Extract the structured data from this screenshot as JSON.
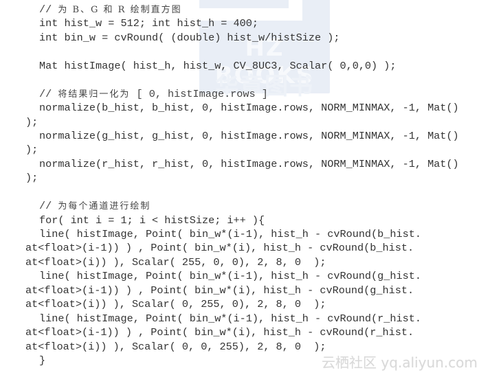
{
  "watermarks": {
    "publisher_en": "HZ BOOKS",
    "publisher_cn": "华章图书",
    "site": "云栖社区 yq.aliyun.com"
  },
  "code": {
    "lines": [
      {
        "type": "comment",
        "indent": "ind",
        "prefix": "// ",
        "text": "为 B、G 和 R 绘制直方图",
        "suffix": ""
      },
      {
        "type": "code",
        "indent": "ind",
        "text": "int hist_w = 512; int hist_h = 400;"
      },
      {
        "type": "code",
        "indent": "ind",
        "text": "int bin_w = cvRound( (double) hist_w/histSize );"
      },
      {
        "type": "blank"
      },
      {
        "type": "code",
        "indent": "ind",
        "text": "Mat histImage( hist_h, hist_w, CV_8UC3, Scalar( 0,0,0) );"
      },
      {
        "type": "blank"
      },
      {
        "type": "comment",
        "indent": "ind",
        "prefix": "// ",
        "text": "将结果归一化为",
        "suffix": " [ 0, histImage.rows ]"
      },
      {
        "type": "code",
        "indent": "ind",
        "text": "normalize(b_hist, b_hist, 0, histImage.rows, NORM_MINMAX, -1, Mat()"
      },
      {
        "type": "code",
        "indent": "cont",
        "text": ");"
      },
      {
        "type": "code",
        "indent": "ind",
        "text": "normalize(g_hist, g_hist, 0, histImage.rows, NORM_MINMAX, -1, Mat()"
      },
      {
        "type": "code",
        "indent": "cont",
        "text": ");"
      },
      {
        "type": "code",
        "indent": "ind",
        "text": "normalize(r_hist, r_hist, 0, histImage.rows, NORM_MINMAX, -1, Mat()"
      },
      {
        "type": "code",
        "indent": "cont",
        "text": ");"
      },
      {
        "type": "blank"
      },
      {
        "type": "comment",
        "indent": "ind",
        "prefix": "// ",
        "text": "为每个通道进行绘制",
        "suffix": ""
      },
      {
        "type": "code",
        "indent": "ind",
        "text": "for( int i = 1; i < histSize; i++ ){"
      },
      {
        "type": "code",
        "indent": "ind",
        "text": "line( histImage, Point( bin_w*(i-1), hist_h - cvRound(b_hist."
      },
      {
        "type": "code",
        "indent": "cont",
        "text": "at<float>(i-1)) ) , Point( bin_w*(i), hist_h - cvRound(b_hist."
      },
      {
        "type": "code",
        "indent": "cont",
        "text": "at<float>(i)) ), Scalar( 255, 0, 0), 2, 8, 0  );"
      },
      {
        "type": "code",
        "indent": "ind",
        "text": "line( histImage, Point( bin_w*(i-1), hist_h - cvRound(g_hist."
      },
      {
        "type": "code",
        "indent": "cont",
        "text": "at<float>(i-1)) ) , Point( bin_w*(i), hist_h - cvRound(g_hist."
      },
      {
        "type": "code",
        "indent": "cont",
        "text": "at<float>(i)) ), Scalar( 0, 255, 0), 2, 8, 0  );"
      },
      {
        "type": "code",
        "indent": "ind",
        "text": "line( histImage, Point( bin_w*(i-1), hist_h - cvRound(r_hist."
      },
      {
        "type": "code",
        "indent": "cont",
        "text": "at<float>(i-1)) ) , Point( bin_w*(i), hist_h - cvRound(r_hist."
      },
      {
        "type": "code",
        "indent": "cont",
        "text": "at<float>(i)) ), Scalar( 0, 0, 255), 2, 8, 0  );"
      },
      {
        "type": "code",
        "indent": "ind",
        "text": "}"
      }
    ]
  }
}
